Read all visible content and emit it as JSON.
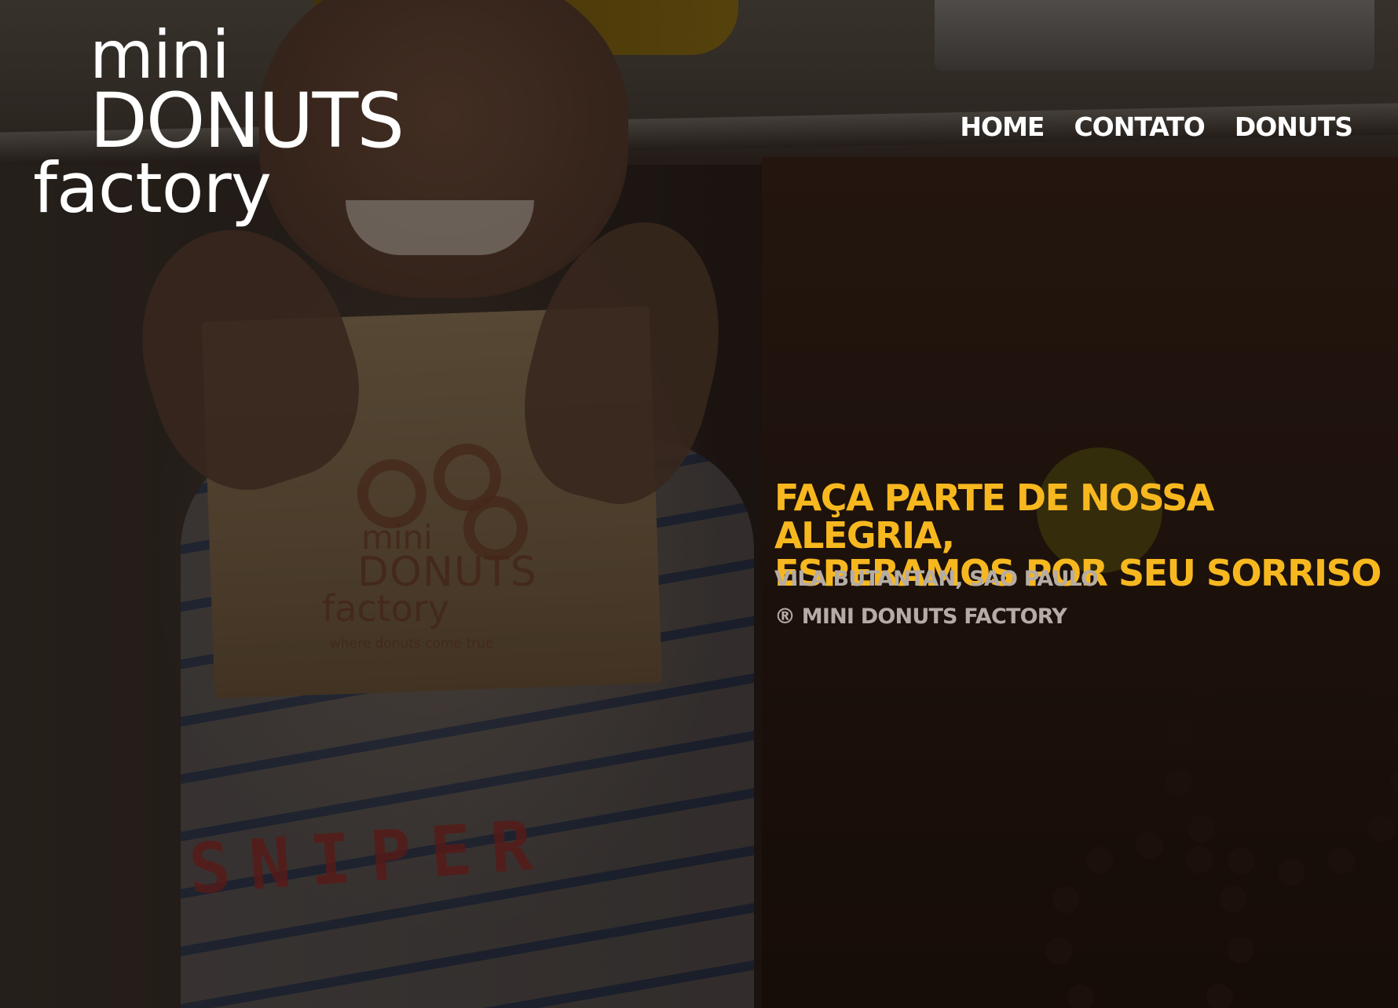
{
  "logo": {
    "line1": "mini",
    "line2": "DONUTS",
    "line3": "factory"
  },
  "nav": {
    "items": [
      {
        "label": "HOME"
      },
      {
        "label": "CONTATO"
      },
      {
        "label": "DONUTS"
      }
    ]
  },
  "hero": {
    "headline_line1": "FAÇA PARTE DE NOSSA ALEGRIA,",
    "headline_line2": "ESPERAMOS POR SEU SORRISO",
    "location": "VILA BUTANTAN, SAO PAULO",
    "copyright": "® MINI DONUTS FACTORY",
    "photo": {
      "bag_logo_line1": "mini",
      "bag_logo_line2": "DONUTS",
      "bag_logo_line3": "factory",
      "bag_tagline": "where donuts come true",
      "shirt_text": "SNIPER"
    }
  },
  "colors": {
    "accent": "#f7b81f",
    "nav_text": "#ffffff",
    "muted_text": "#b5aca6"
  }
}
